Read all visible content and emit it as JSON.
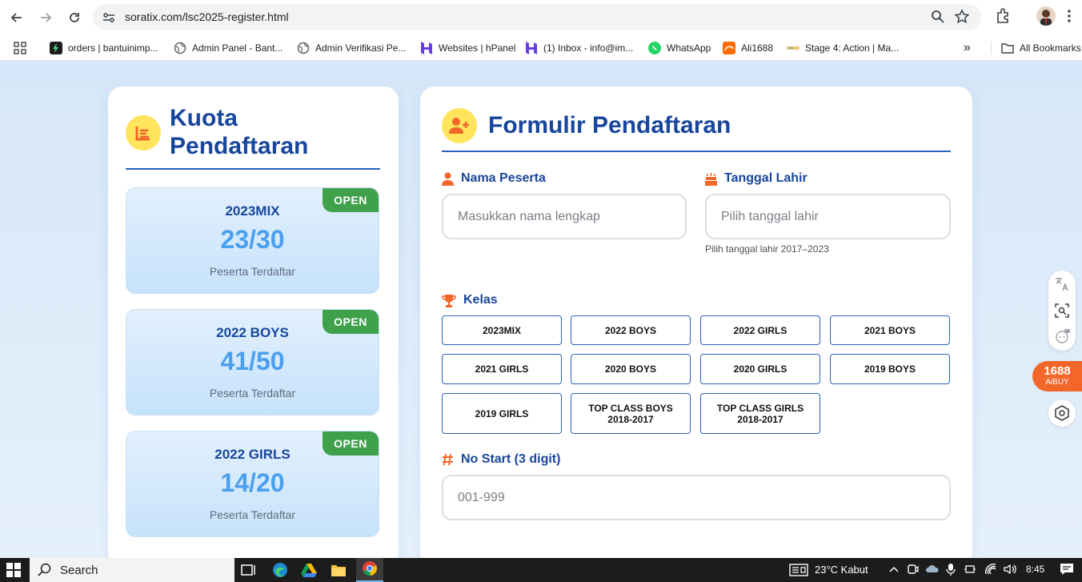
{
  "browser": {
    "url": "soratix.com/lsc2025-register.html",
    "bookmarks": [
      {
        "label": "orders | bantuinimp...",
        "icon": "bolt-icon"
      },
      {
        "label": "Admin Panel - Bant...",
        "icon": "globe-icon"
      },
      {
        "label": "Admin Verifikasi Pe...",
        "icon": "globe-icon"
      },
      {
        "label": "Websites | hPanel",
        "icon": "hostinger-icon"
      },
      {
        "label": "(1) Inbox - info@im...",
        "icon": "hostinger-icon"
      },
      {
        "label": "WhatsApp",
        "icon": "whatsapp-icon"
      },
      {
        "label": "Ali1688",
        "icon": "ali1688-icon"
      },
      {
        "label": "Stage 4: Action | Ma...",
        "icon": "stage-icon"
      }
    ],
    "overflow_label": "»",
    "all_bookmarks_label": "All Bookmarks"
  },
  "quota": {
    "title": "Kuota Pendaftaran",
    "items": [
      {
        "name": "2023MIX",
        "count": "23/30",
        "label": "Peserta Terdaftar",
        "badge": "OPEN"
      },
      {
        "name": "2022 BOYS",
        "count": "41/50",
        "label": "Peserta Terdaftar",
        "badge": "OPEN"
      },
      {
        "name": "2022 GIRLS",
        "count": "14/20",
        "label": "Peserta Terdaftar",
        "badge": "OPEN"
      }
    ]
  },
  "form": {
    "title": "Formulir Pendaftaran",
    "name_label": "Nama Peserta",
    "name_placeholder": "Masukkan nama lengkap",
    "dob_label": "Tanggal Lahir",
    "dob_placeholder": "Pilih tanggal lahir",
    "dob_hint": "Pilih tanggal lahir 2017–2023",
    "kelas_label": "Kelas",
    "kelas_options": [
      "2023MIX",
      "2022 BOYS",
      "2022 GIRLS",
      "2021 BOYS",
      "2021 GIRLS",
      "2020 BOYS",
      "2020 GIRLS",
      "2019 BOYS",
      "2019 GIRLS",
      "TOP CLASS BOYS 2018-2017",
      "TOP CLASS GIRLS 2018-2017"
    ],
    "nostart_label": "No Start (3 digit)",
    "nostart_placeholder": "001-999"
  },
  "extension": {
    "aibuy_number": "1688",
    "aibuy_text": "AiBUY"
  },
  "taskbar": {
    "search_label": "Search",
    "weather": "23°C  Kabut",
    "time": "8:45"
  },
  "colors": {
    "primary": "#17469c",
    "accent": "#f2662a",
    "badge": "#3fa24b",
    "count": "#4aa0ee"
  }
}
